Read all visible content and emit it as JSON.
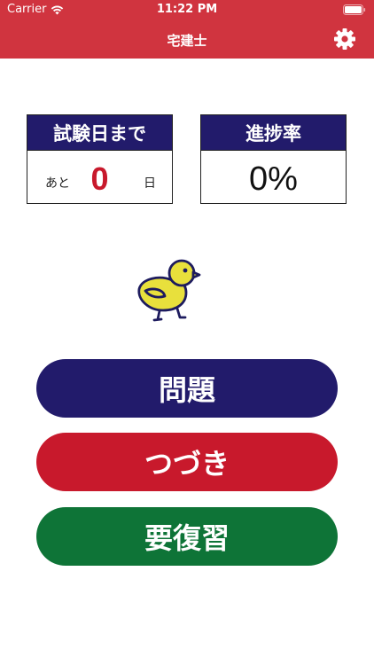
{
  "status_bar": {
    "carrier": "Carrier",
    "time": "11:22 PM",
    "icons": [
      "wifi-icon",
      "battery-icon"
    ]
  },
  "nav": {
    "title": "宅建士",
    "settings_icon": "gear-icon"
  },
  "exam_countdown": {
    "header": "試験日まで",
    "prefix": "あと",
    "days": "0",
    "suffix": "日"
  },
  "progress": {
    "header": "進捗率",
    "value": "0%"
  },
  "mascot": {
    "icon": "chick-icon",
    "color": "#e8e03c"
  },
  "buttons": {
    "questions": "問題",
    "continue": "つづき",
    "review": "要復習"
  },
  "colors": {
    "header_bg": "#d0343f",
    "navy": "#221b6b",
    "red": "#c8192c",
    "green": "#0e7437"
  }
}
